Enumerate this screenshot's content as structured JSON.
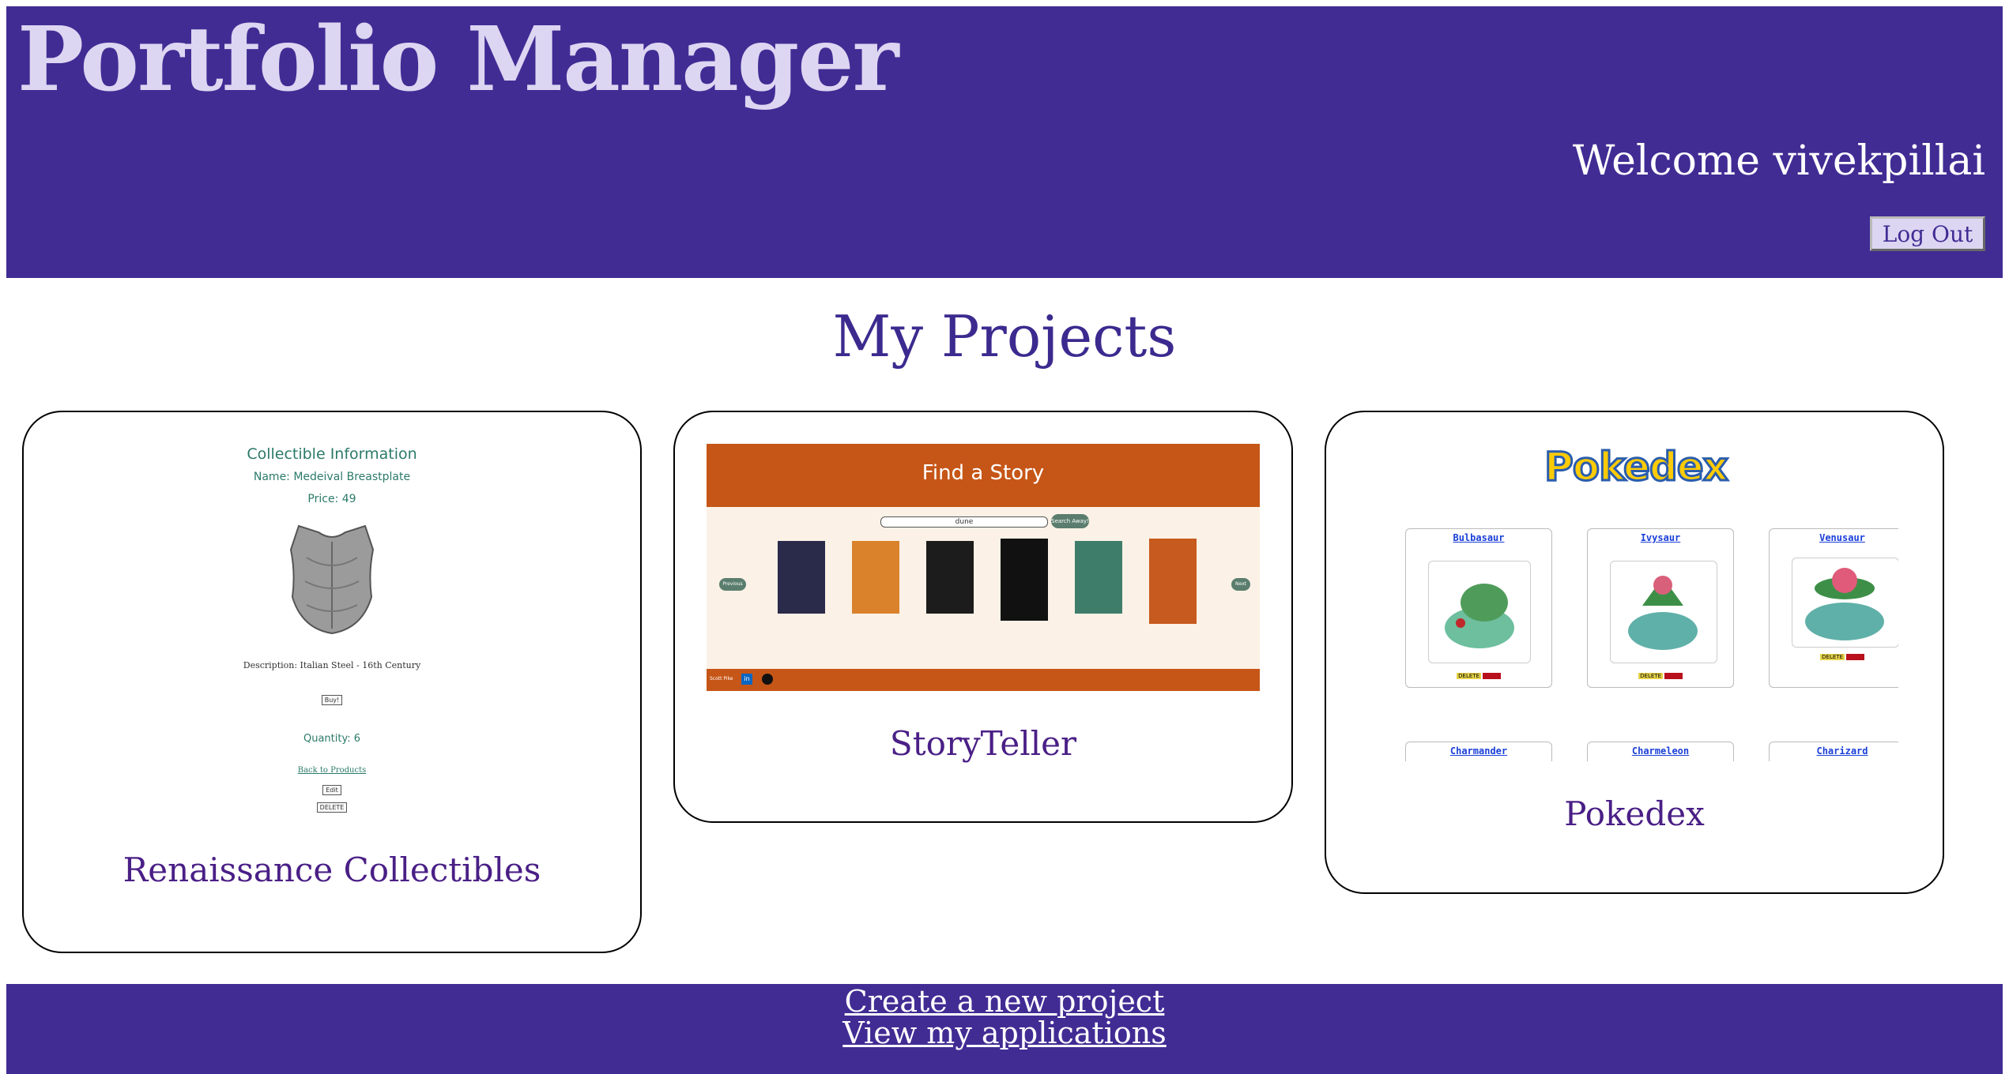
{
  "header": {
    "app_title": "Portfolio Manager",
    "welcome": "Welcome vivekpillai",
    "logout_label": "Log Out"
  },
  "main": {
    "title": "My Projects",
    "projects": [
      {
        "title": "Renaissance Collectibles",
        "preview": {
          "heading": "Collectible Information",
          "name": "Name: Medeival Breastplate",
          "price": "Price: 49",
          "description": "Description: Italian Steel - 16th Century",
          "buy_label": "Buy!",
          "quantity": "Quantity: 6",
          "back_link": "Back to Products",
          "edit_label": "Edit",
          "delete_label": "DELETE"
        }
      },
      {
        "title": "StoryTeller",
        "preview": {
          "heading": "Find a Story",
          "search_value": "dune",
          "search_button": "Search Away!",
          "previous_label": "Previous",
          "next_label": "Next",
          "footer_text": "Scott Pike",
          "book_colors": [
            "#2a2a4a",
            "#d9822b",
            "#1c1c1c",
            "#111111",
            "#3f7d6b",
            "#c75a1e"
          ]
        }
      },
      {
        "title": "Pokedex",
        "preview": {
          "logo_text": "Pokedex",
          "pokemon": [
            "Bulbasaur",
            "Ivysaur",
            "Venusaur",
            "Charmander",
            "Charmeleon",
            "Charizard"
          ],
          "delete_label": "DELETE"
        }
      }
    ]
  },
  "footer": {
    "create_link": "Create a new project",
    "applications_link": "View my applications"
  },
  "colors": {
    "brand_purple": "#412c94",
    "header_title": "#dcd6f2",
    "card_title": "#4a1f86",
    "story_orange": "#c65617"
  }
}
